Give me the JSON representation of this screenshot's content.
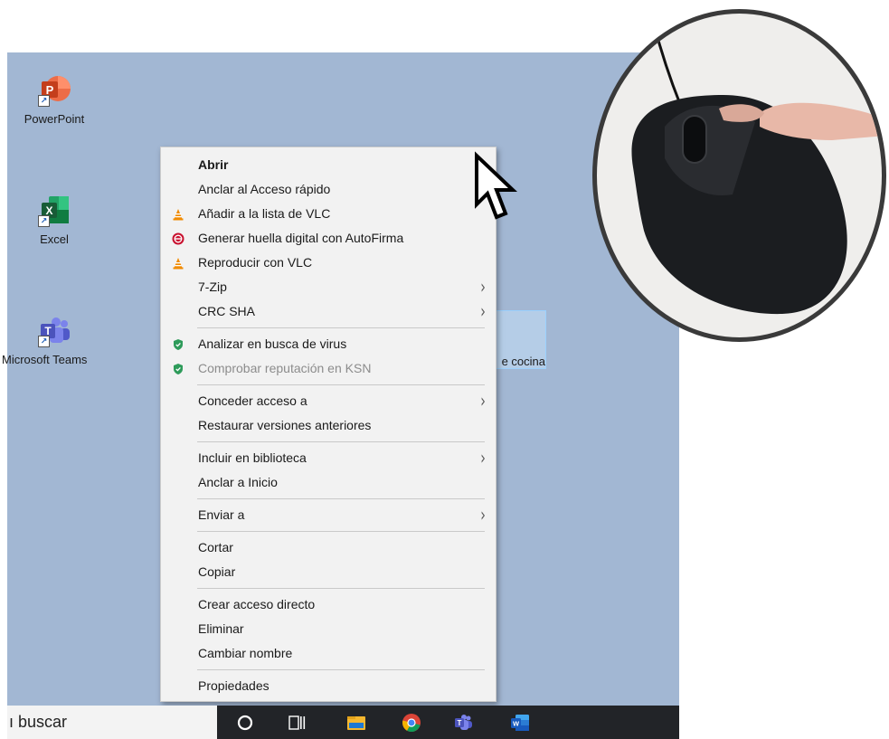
{
  "desktop_icons": [
    {
      "label": "PowerPoint",
      "icon": "powerpoint-icon",
      "color": "#d24726"
    },
    {
      "label": "Excel",
      "icon": "excel-icon",
      "color": "#1d6f42"
    },
    {
      "label": "Microsoft Teams",
      "icon": "teams-icon",
      "color": "#5059c9"
    }
  ],
  "selected_icon": {
    "label": "e cocina"
  },
  "context_menu": {
    "items": [
      {
        "label": "Abrir"
      },
      {
        "label": "Anclar al Acceso rápido"
      },
      {
        "label": "Añadir a la lista de VLC",
        "icon": "vlc-icon"
      },
      {
        "label": "Generar huella digital con AutoFirma",
        "icon": "autofirma-icon"
      },
      {
        "label": "Reproducir con VLC",
        "icon": "vlc-icon"
      },
      {
        "label": "7-Zip",
        "submenu": true
      },
      {
        "label": "CRC SHA",
        "submenu": true
      },
      {
        "label": "Analizar en busca de virus",
        "icon": "kaspersky-shield-icon"
      },
      {
        "label": "Comprobar reputación en KSN",
        "icon": "kaspersky-shield-icon",
        "disabled": true
      },
      {
        "label": "Conceder acceso a",
        "submenu": true
      },
      {
        "label": "Restaurar versiones anteriores"
      },
      {
        "label": "Incluir en biblioteca",
        "submenu": true
      },
      {
        "label": "Anclar a Inicio"
      },
      {
        "label": "Enviar a",
        "submenu": true
      },
      {
        "label": "Cortar"
      },
      {
        "label": "Copiar"
      },
      {
        "label": "Crear acceso directo"
      },
      {
        "label": "Eliminar"
      },
      {
        "label": "Cambiar nombre"
      },
      {
        "label": "Propiedades"
      }
    ],
    "submenu_glyph": "›"
  },
  "taskbar": {
    "search_text": "ı buscar",
    "icons": [
      "cortana-circle-icon",
      "task-view-icon",
      "file-explorer-icon",
      "chrome-icon",
      "teams-icon",
      "word-icon"
    ]
  },
  "colors": {
    "desktop_bg": "#a2b7d3",
    "menu_bg": "#f2f2f2",
    "taskbar_bg": "#222428",
    "kaspersky_green": "#2e9b5a",
    "vlc_orange": "#f08a00",
    "autofirma_red": "#c8102e"
  }
}
